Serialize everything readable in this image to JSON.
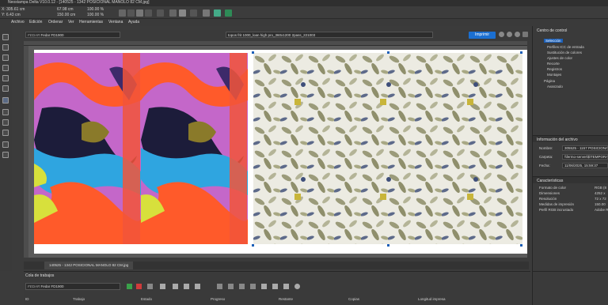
{
  "window": {
    "title": "Neostampa Delta V10.0.12 - [140525 - 1342 POSICIONAL MANOLO 82 CM.jpg]"
  },
  "toolbar": {
    "x": "X: 305.61 cm",
    "y": "Y: 6.43 cm",
    "w": "67.98 cm",
    "h": "150.00 cm",
    "zoom_w": "100.00 %",
    "zoom_h": "100.00 %"
  },
  "menu": [
    "Archivo",
    "Edición",
    "Ordenar",
    "Ver",
    "Herramientas",
    "Ventana",
    "Ayuda"
  ],
  "docbar": {
    "printer": "Fedar FD1900",
    "layout": "topos frit 1000_loan high pro_360x1200 2pass_221003",
    "print_label": "Imprimir"
  },
  "document_tab": "140525 - 1342 POSICIONAL MANOLO 82 CM.jpg",
  "control_center": {
    "title": "Centro de control",
    "items": [
      "Selección",
      "Perfiles ICC de entrada",
      "Sustitución de colores",
      "Ajustes de color",
      "Recorte",
      "Registros",
      "Montajes",
      "Página",
      "Avanzado"
    ]
  },
  "file_info": {
    "title": "Información del archivo",
    "name_label": "Nombre:",
    "name_value": "305525 - 1157 POSICIONAL",
    "folder_label": "Carpeta:",
    "folder_value": "\\\\fermo-server\\$\\TEMPORAL",
    "date_label": "Fecha:",
    "date_value": "11/06/2025, 15:59:37"
  },
  "characteristics": {
    "title": "Características",
    "rows": [
      {
        "label": "Formato de color",
        "value": "RGB (8"
      },
      {
        "label": "Dimensiones",
        "value": "4252 x"
      },
      {
        "label": "Resolución",
        "value": "72 x 72"
      },
      {
        "label": "Medidas de impresión",
        "value": "150.00"
      },
      {
        "label": "Perfil RGB incrustado",
        "value": "Adobe R"
      }
    ]
  },
  "queue": {
    "title": "Cola de trabajos",
    "printer": "Fedar FD1900",
    "columns": [
      "ID",
      "Trabajo",
      "Estado",
      "Progreso",
      "Restante",
      "Copias",
      "Longitud impresa"
    ]
  },
  "colors": {
    "accent": "#1b6fd1",
    "panel": "#3a3a3a",
    "dark": "#2c2c2c"
  }
}
